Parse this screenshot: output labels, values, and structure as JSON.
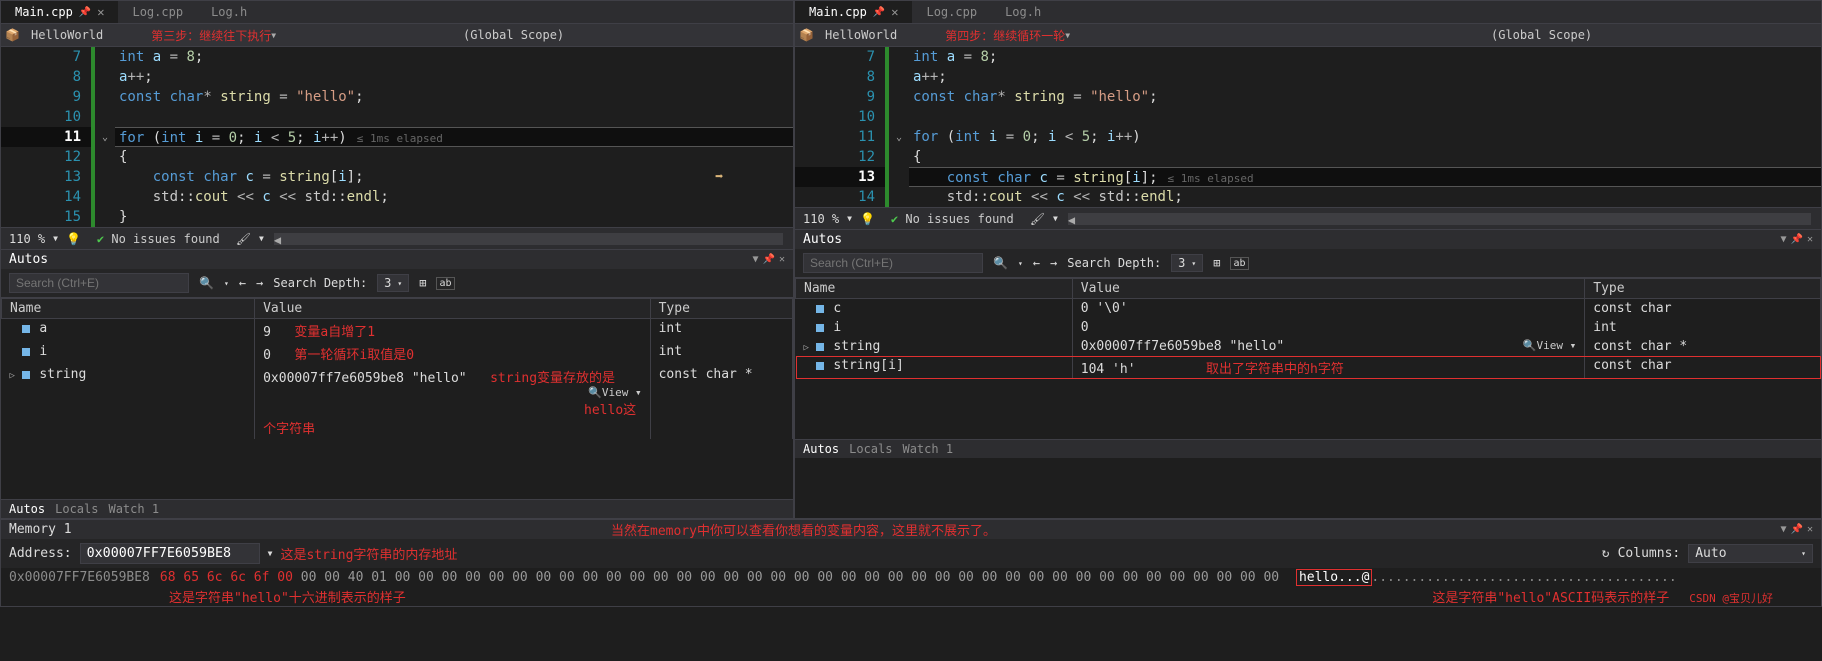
{
  "left": {
    "tabs": [
      "Main.cpp",
      "Log.cpp",
      "Log.h"
    ],
    "activeTab": 0,
    "project": "HelloWorld",
    "stepNote": "第三步：继续往下执行",
    "scope": "(Global Scope)",
    "lines": {
      "7": "int a = 8;",
      "8": "a++;",
      "9": "const char* string = \"hello\";",
      "10": "",
      "11": "for (int i = 0; i < 5; i++)",
      "12": "{",
      "13": "    const char c = string[i];",
      "14": "    std::cout << c << std::endl;",
      "15": "}"
    },
    "execLine": 11,
    "elapsed": "≤ 1ms elapsed",
    "zoom": "110 %",
    "issues": "No issues found",
    "autos": {
      "title": "Autos",
      "searchPlaceholder": "Search (Ctrl+E)",
      "searchDepthLabel": "Search Depth:",
      "searchDepth": "3",
      "cols": [
        "Name",
        "Value",
        "Type"
      ],
      "rows": [
        {
          "name": "a",
          "value": "9",
          "type": "int",
          "note": "变量a自增了1"
        },
        {
          "name": "i",
          "value": "0",
          "type": "int",
          "note": "第一轮循环i取值是0"
        },
        {
          "name": "string",
          "value": "0x00007ff7e6059be8 \"hello\"",
          "type": "const char *",
          "expand": true,
          "view": true,
          "note": "string变量存放的是",
          "note2": "hello这个字符串"
        }
      ],
      "footerTabs": [
        "Autos",
        "Locals",
        "Watch 1"
      ]
    }
  },
  "right": {
    "tabs": [
      "Main.cpp",
      "Log.cpp",
      "Log.h"
    ],
    "project": "HelloWorld",
    "stepNote": "第四步：继续循环一轮",
    "scope": "(Global Scope)",
    "lines": {
      "7": "int a = 8;",
      "8": "a++;",
      "9": "const char* string = \"hello\";",
      "10": "",
      "11": "for (int i = 0; i < 5; i++)",
      "12": "{",
      "13": "    const char c = string[i];",
      "14": "    std::cout << c << std::endl;"
    },
    "execLine": 13,
    "elapsed": "≤ 1ms elapsed",
    "zoom": "110 %",
    "issues": "No issues found",
    "autos": {
      "title": "Autos",
      "searchPlaceholder": "Search (Ctrl+E)",
      "searchDepthLabel": "Search Depth:",
      "searchDepth": "3",
      "cols": [
        "Name",
        "Value",
        "Type"
      ],
      "rows": [
        {
          "name": "c",
          "value": "0 '\\0'",
          "type": "const char"
        },
        {
          "name": "i",
          "value": "0",
          "type": "int"
        },
        {
          "name": "string",
          "value": "0x00007ff7e6059be8 \"hello\"",
          "type": "const char *",
          "expand": true,
          "view": true
        },
        {
          "name": "string[i]",
          "value": "104 'h'",
          "type": "const char",
          "highlight": true,
          "note": "取出了字符串中的h字符"
        }
      ],
      "footerTabs": [
        "Autos",
        "Locals",
        "Watch 1"
      ]
    }
  },
  "memory": {
    "title": "Memory 1",
    "topNote": "当然在memory中你可以查看你想看的变量内容，这里就不展示了。",
    "addressLabel": "Address:",
    "address": "0x00007FF7E6059BE8",
    "addrNote": "这是string字符串的内存地址",
    "columnsLabel": "Columns:",
    "columns": "Auto",
    "hexAddr": "0x00007FF7E6059BE8",
    "hexHello": "68 65 6c 6c 6f 00",
    "hexRest": " 00 00 40 01 00 00 00 00 00 00 00 00 00 00 00 00 00 00 00 00 00 00 00 00 00 00 00 00 00 00 00 00 00 00 00 00 00 00 00 00 00 00 ",
    "ascii": "hello...@",
    "asciiDots": ".......................................",
    "bottomLeft": "这是字符串\"hello\"十六进制表示的样子",
    "bottomRight": "这是字符串\"hello\"ASCII码表示的样子",
    "watermark": "CSDN @宝贝儿好"
  }
}
